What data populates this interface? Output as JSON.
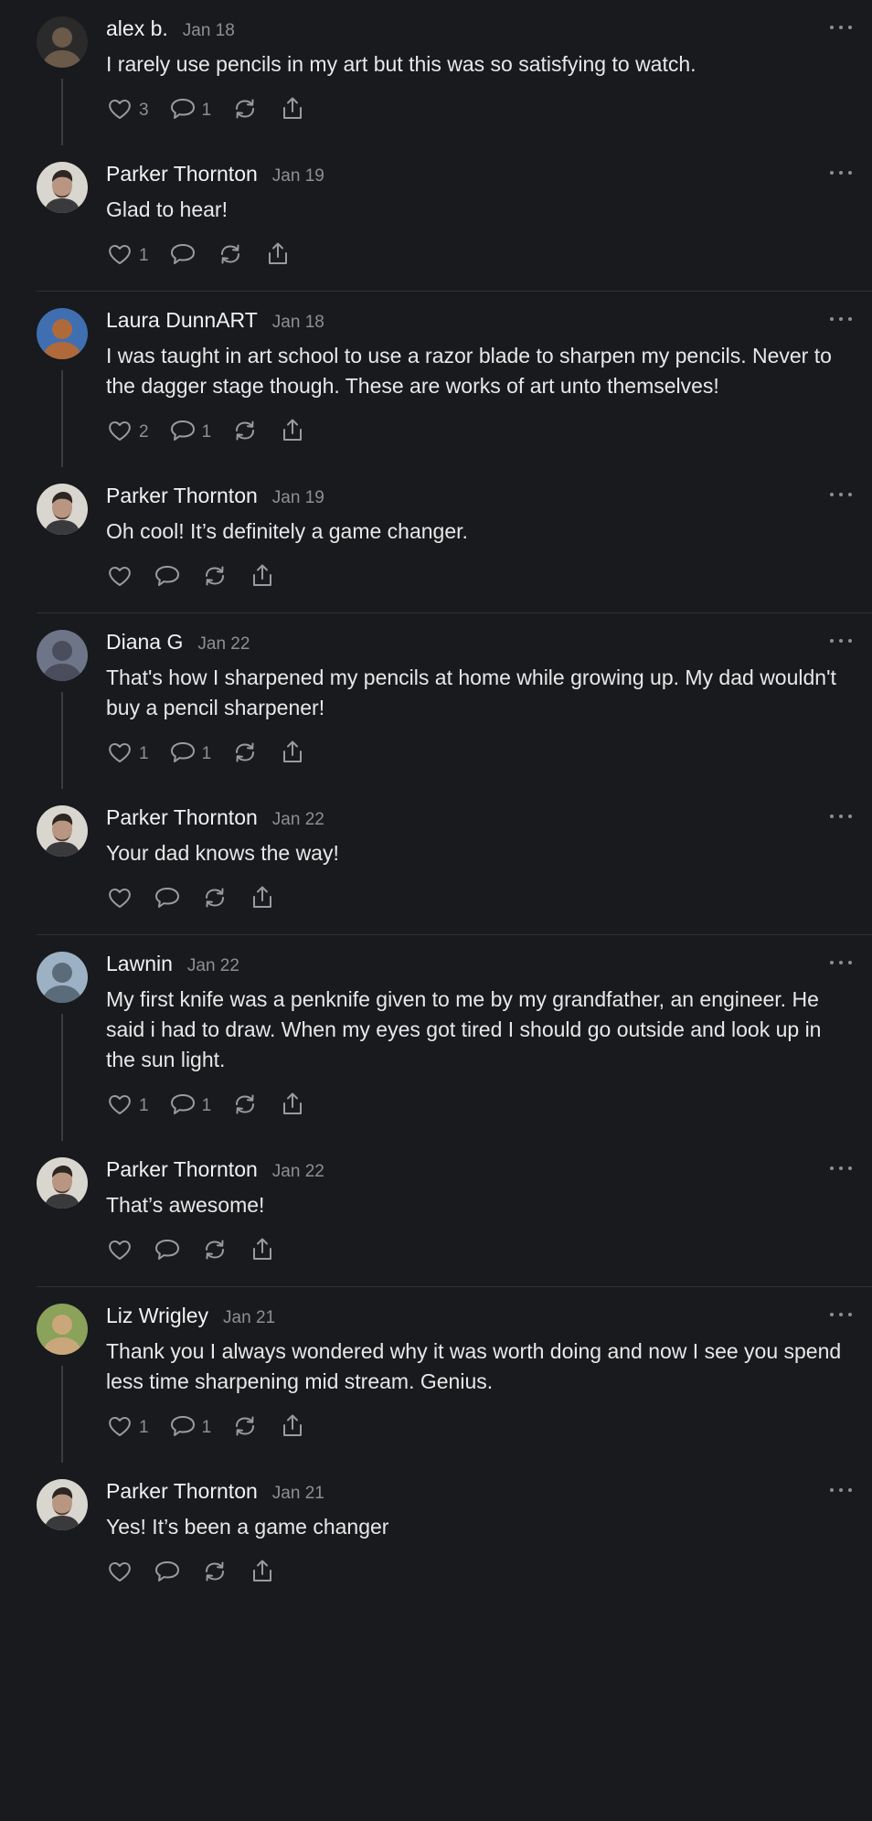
{
  "threads": [
    {
      "comment": {
        "author": "alex b.",
        "date": "Jan 18",
        "avatar": "avatar-alex",
        "avatar_colors": [
          "#2b2a2b",
          "#6b5a4a"
        ],
        "text": "I rarely use pencils in my art but this was so satisfying to watch.",
        "likes": "3",
        "replies": "1"
      },
      "reply": {
        "author": "Parker Thornton",
        "date": "Jan 19",
        "avatar": "avatar-parker",
        "text": "Glad to hear!",
        "likes": "1",
        "replies": ""
      }
    },
    {
      "comment": {
        "author": "Laura DunnART",
        "date": "Jan 18",
        "avatar": "avatar-laura",
        "avatar_colors": [
          "#3f6fb0",
          "#b06a3a"
        ],
        "text": "I was taught in art school to use a razor blade to sharpen my pencils. Never to the dagger stage though. These are works of art unto themselves!",
        "likes": "2",
        "replies": "1"
      },
      "reply": {
        "author": "Parker Thornton",
        "date": "Jan 19",
        "avatar": "avatar-parker",
        "text": "Oh cool! It’s definitely a game changer.",
        "likes": "",
        "replies": ""
      }
    },
    {
      "comment": {
        "author": "Diana G",
        "date": "Jan 22",
        "avatar": "avatar-diana",
        "avatar_colors": [
          "#6e7588",
          "#4a4e5c"
        ],
        "text": "That's how I sharpened my pencils at home while growing up. My dad wouldn't buy a pencil sharpener!",
        "likes": "1",
        "replies": "1"
      },
      "reply": {
        "author": "Parker Thornton",
        "date": "Jan 22",
        "avatar": "avatar-parker",
        "text": "Your dad knows the way!",
        "likes": "",
        "replies": ""
      }
    },
    {
      "comment": {
        "author": "Lawnin",
        "date": "Jan 22",
        "avatar": "avatar-lawnin",
        "avatar_colors": [
          "#9db1c4",
          "#5a6b7a"
        ],
        "text": "My first knife was a penknife given to me by my grandfather, an engineer. He said i had to draw. When my eyes got tired I should go outside and look up in the sun light.",
        "likes": "1",
        "replies": "1"
      },
      "reply": {
        "author": "Parker Thornton",
        "date": "Jan 22",
        "avatar": "avatar-parker",
        "text": "That’s awesome!",
        "likes": "",
        "replies": ""
      }
    },
    {
      "comment": {
        "author": "Liz Wrigley",
        "date": "Jan 21",
        "avatar": "avatar-liz",
        "avatar_colors": [
          "#8aa25a",
          "#c9a77a"
        ],
        "text": "Thank you I always wondered why it was worth doing and now I see you spend less time sharpening mid stream. Genius.",
        "likes": "1",
        "replies": "1"
      },
      "reply": {
        "author": "Parker Thornton",
        "date": "Jan 21",
        "avatar": "avatar-parker",
        "text": "Yes! It’s been a game changer",
        "likes": "",
        "replies": ""
      }
    }
  ],
  "icons": {
    "like": "heart-icon",
    "reply": "comment-icon",
    "repost": "repost-icon",
    "share": "share-icon",
    "more": "more-icon"
  },
  "colors": {
    "background": "#181a1d",
    "text": "#ececec",
    "muted": "#8e8f93",
    "divider": "#2f3135"
  }
}
